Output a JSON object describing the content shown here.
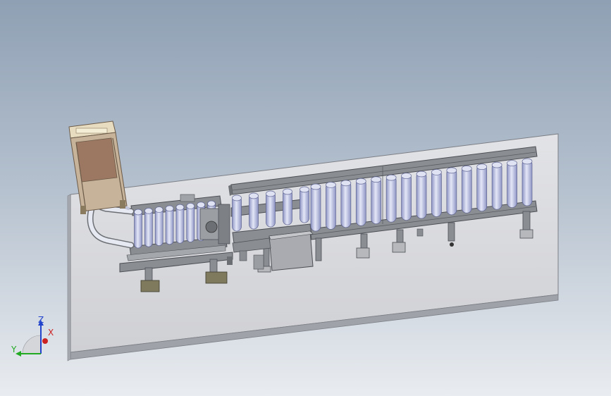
{
  "viewport": {
    "background_top": "#8fa0b4",
    "background_bottom": "#e9ecf0"
  },
  "colors": {
    "base_plate": "#d9dadd",
    "base_plate_edge": "#7c7f86",
    "frame_steel": "#8a8d92",
    "frame_dark": "#4c4f55",
    "roller": "#c5cbe8",
    "roller_shade": "#8e95c4",
    "gate_panel": "#9c7862",
    "gate_frame": "#c7b39a",
    "axis_x": "#cc2222",
    "axis_y": "#22aa22",
    "axis_z": "#2244cc"
  },
  "triad": {
    "z_label": "Z",
    "y_label": "Y",
    "x_label": "X"
  }
}
